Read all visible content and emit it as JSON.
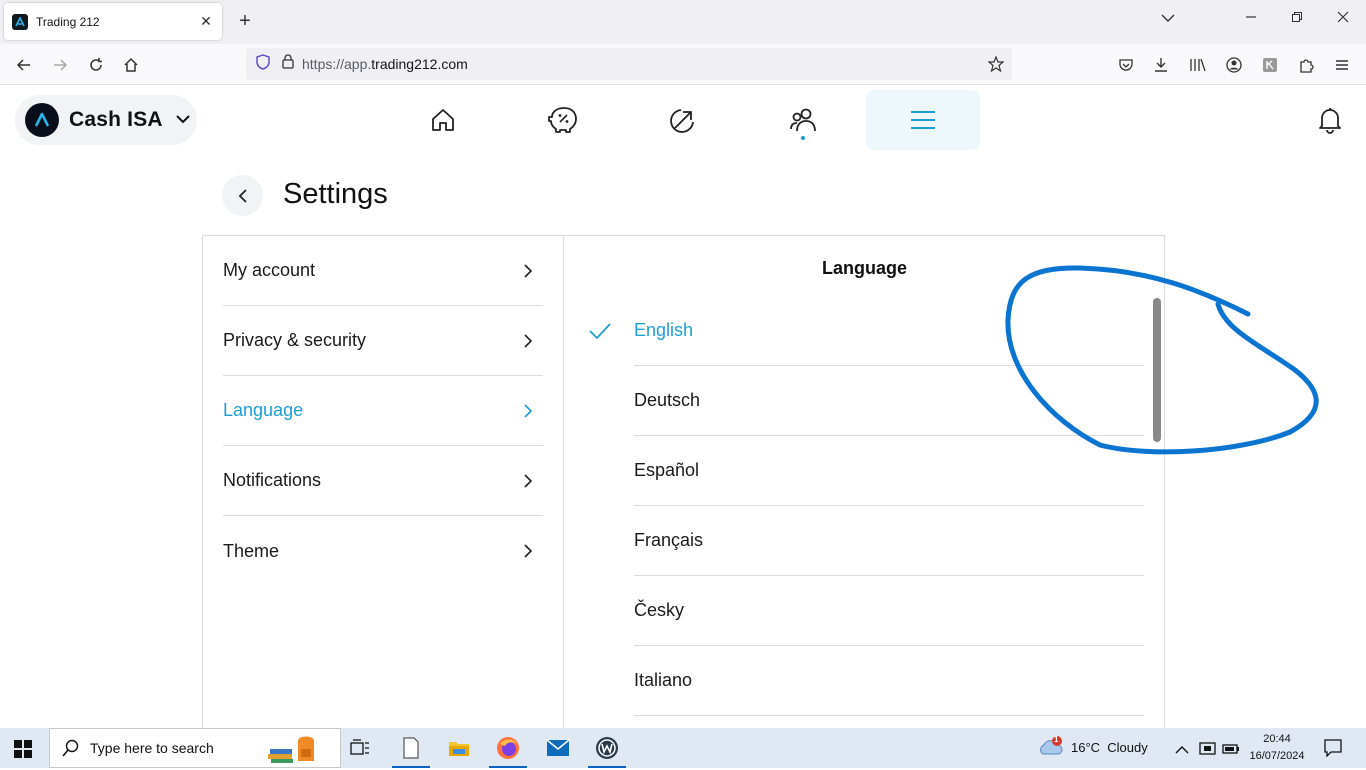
{
  "browser": {
    "tab_title": "Trading 212",
    "url_prefix": "https://app.",
    "url_domain": "trading212.com"
  },
  "header": {
    "account_name": "Cash ISA"
  },
  "settings": {
    "title": "Settings",
    "menu": [
      {
        "label": "My account"
      },
      {
        "label": "Privacy & security"
      },
      {
        "label": "Language",
        "active": true
      },
      {
        "label": "Notifications"
      },
      {
        "label": "Theme"
      }
    ],
    "language": {
      "title": "Language",
      "selected": "English",
      "options": [
        "English",
        "Deutsch",
        "Español",
        "Français",
        "Česky",
        "Italiano"
      ]
    }
  },
  "taskbar": {
    "search_placeholder": "Type here to search",
    "weather_temp": "16°C",
    "weather_desc": "Cloudy",
    "weather_badge": "1",
    "time": "20:44",
    "date": "16/07/2024"
  },
  "colors": {
    "accent": "#1e9ed4",
    "annotation": "#0a74d0"
  }
}
